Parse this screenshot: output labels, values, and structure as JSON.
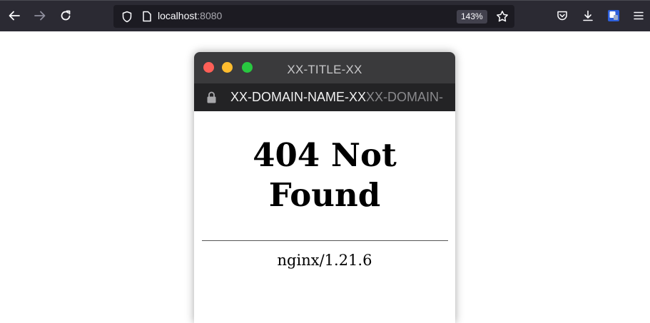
{
  "browser": {
    "url_host": "localhost",
    "url_port": ":8080",
    "zoom": "143%"
  },
  "mock_window": {
    "title": "XX-TITLE-XX",
    "domain_primary": "XX-DOMAIN-NAME-XX",
    "domain_secondary": "XX-DOMAIN-"
  },
  "page": {
    "heading_line1": "404 Not",
    "heading_line2": "Found",
    "server": "nginx/1.21.6"
  },
  "colors": {
    "toolbar_bg": "#2b2a33",
    "urlbar_bg": "#1c1b22",
    "traffic_red": "#fe5f57",
    "traffic_yellow": "#febc2e",
    "traffic_green": "#28c840"
  }
}
